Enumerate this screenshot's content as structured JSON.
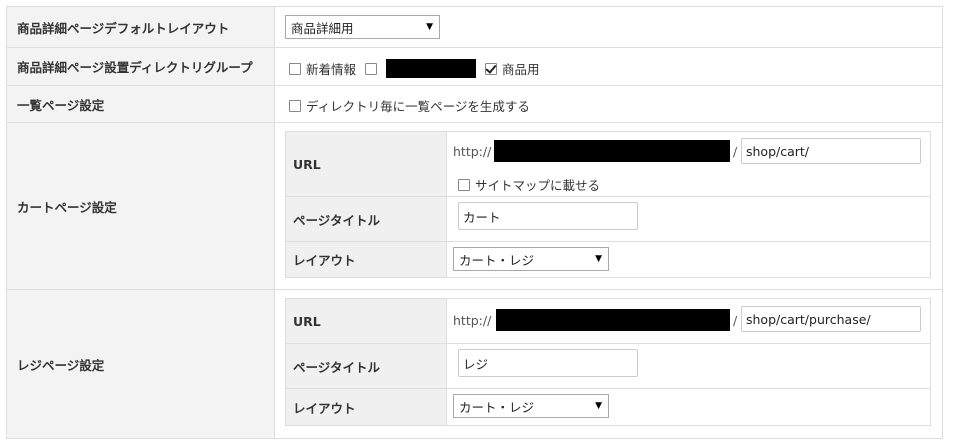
{
  "rows": {
    "default_layout": {
      "label": "商品詳細ページデフォルトレイアウト",
      "select_value": "商品詳細用"
    },
    "directory_group": {
      "label": "商品詳細ページ設置ディレクトリグループ",
      "opt1": "新着情報",
      "opt3": "商品用"
    },
    "list_page": {
      "label": "一覧ページ設定",
      "checkbox_label": "ディレクトリ毎に一覧ページを生成する"
    },
    "cart_page": {
      "label": "カートページ設定",
      "url_label": "URL",
      "url_prefix": "http://",
      "url_slash": "/",
      "url_value": "shop/cart/",
      "sitemap_label": "サイトマップに載せる",
      "title_label": "ページタイトル",
      "title_value": "カート",
      "layout_label": "レイアウト",
      "layout_value": "カート・レジ"
    },
    "register_page": {
      "label": "レジページ設定",
      "url_label": "URL",
      "url_prefix": "http://",
      "url_slash": "/",
      "url_value": "shop/cart/purchase/",
      "title_label": "ページタイトル",
      "title_value": "レジ",
      "layout_label": "レイアウト",
      "layout_value": "カート・レジ"
    }
  },
  "icons": {
    "select_caret": "dropdown-caret-icon"
  }
}
